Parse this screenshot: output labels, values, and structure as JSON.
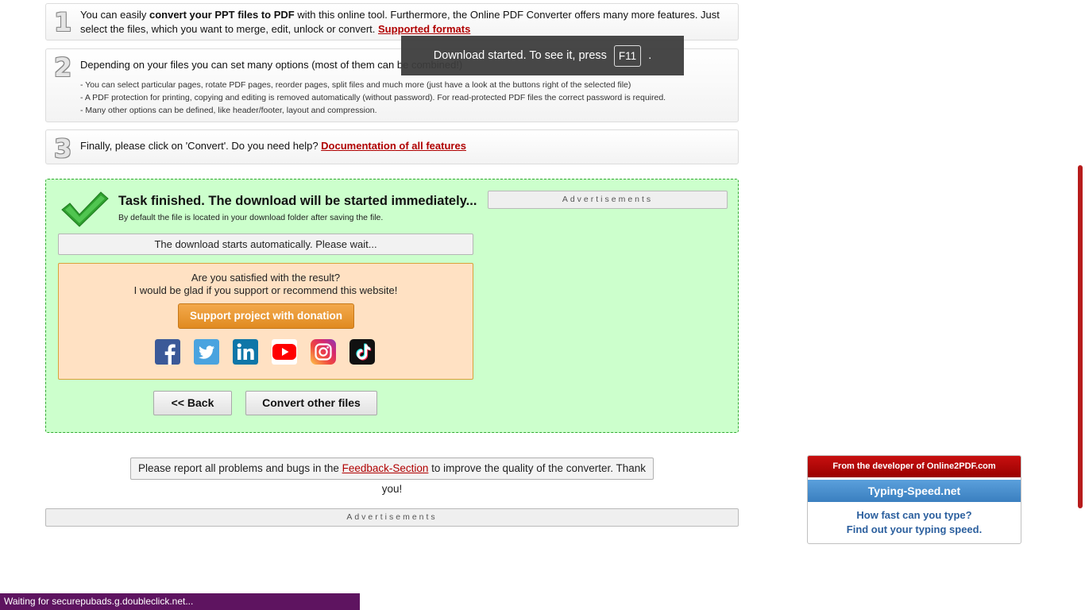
{
  "steps": {
    "step1": {
      "number": "1",
      "text_a": "You can easily ",
      "text_bold": "convert your PPT files to PDF",
      "text_b": " with this online tool. Furthermore, the Online PDF Converter offers many more features. Just select the files, which you want to merge, edit, unlock or convert. ",
      "link": "Supported formats"
    },
    "step2": {
      "number": "2",
      "text": "Depending on your files you can set many options (most of them can be combined!)",
      "items": [
        "- You can select particular pages, rotate PDF pages, reorder pages, split files and much more (just have a look at the buttons right of the selected file)",
        "- A PDF protection for printing, copying and editing is removed automatically (without password). For read-protected PDF files the correct password is required.",
        "- Many other options can be defined, like header/footer, layout and compression."
      ]
    },
    "step3": {
      "number": "3",
      "text": "Finally, please click on 'Convert'. Do you need help? ",
      "link": "Documentation of all features"
    }
  },
  "toast": {
    "text": "Download started. To see it, press",
    "key": "F11",
    "suffix": "."
  },
  "result": {
    "title": "Task finished. The download will be started immediately...",
    "subtitle": "By default the file is located in your download folder after saving the file.",
    "wait_text": "The download starts automatically. Please wait...",
    "ad_label": "Advertisements",
    "donate": {
      "question1": "Are you satisfied with the result?",
      "question2": "I would be glad if you support or recommend this website!",
      "button": "Support project with donation"
    },
    "social": [
      "facebook-icon",
      "twitter-icon",
      "linkedin-icon",
      "youtube-icon",
      "instagram-icon",
      "tiktok-icon"
    ],
    "back_button": "<< Back",
    "convert_other_button": "Convert other files"
  },
  "feedback": {
    "text_a": "Please report all problems and bugs in the ",
    "link": "Feedback-Section",
    "text_b": " to improve the quality of the converter. Thank you!"
  },
  "bottom_ad_label": "Advertisements",
  "developer_box": {
    "header": "From the developer of Online2PDF.com",
    "site": "Typing-Speed.net",
    "line1": "How fast can you type?",
    "line2": "Find out your typing speed."
  },
  "status_bar": "Waiting for securepubads.g.doubleclick.net...",
  "colors": {
    "link": "#b00000",
    "result_bg": "#ccffcc",
    "donate_bg": "#ffe1c3",
    "donate_button": "#e8952e",
    "dev_header": "#b00000",
    "dev_site": "#4a90d0",
    "status_bar": "#5e1460"
  }
}
